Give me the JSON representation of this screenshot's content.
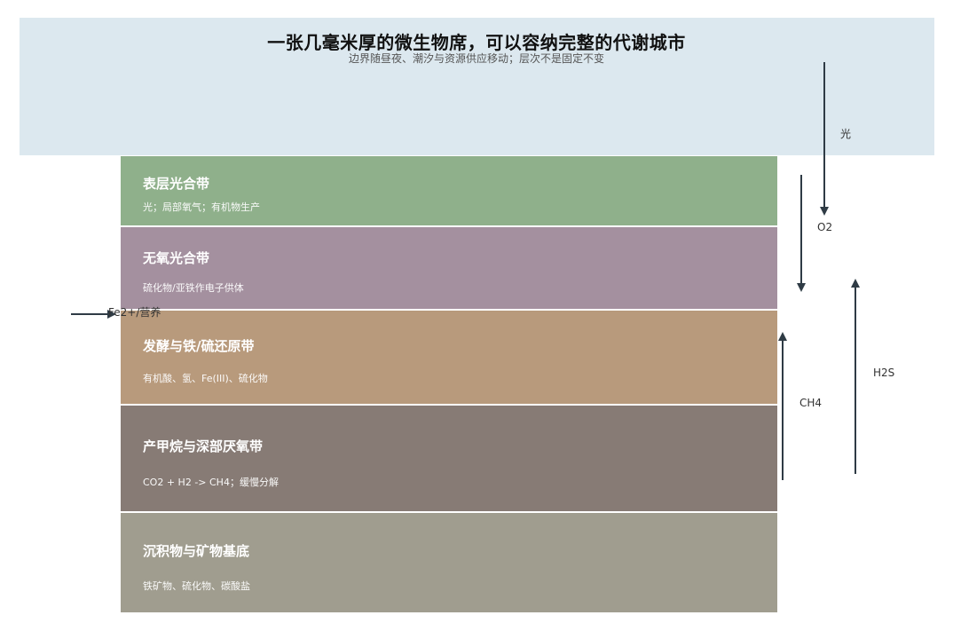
{
  "header": {
    "title": "一张几毫米厚的微生物席，可以容纳完整的代谢城市",
    "subtitle": "边界随昼夜、潮汐与资源供应移动；层次不是固定不变"
  },
  "layers": [
    {
      "name": "表层光合带",
      "desc": "光；局部氧气；有机物生产",
      "color": "#8fb08b"
    },
    {
      "name": "无氧光合带",
      "desc": "硫化物/亚铁作电子供体",
      "color": "#a4909f"
    },
    {
      "name": "发酵与铁/硫还原带",
      "desc": "有机酸、氢、Fe(III)、硫化物",
      "color": "#b89a7c"
    },
    {
      "name": "产甲烷与深部厌氧带",
      "desc": "CO2 + H2 -> CH4；缓慢分解",
      "color": "#877b75"
    },
    {
      "name": "沉积物与矿物基底",
      "desc": "铁矿物、硫化物、碳酸盐",
      "color": "#a09d8f"
    }
  ],
  "flows": {
    "light": "光",
    "o2": "O2",
    "h2s": "H2S",
    "ch4": "CH4",
    "fe": "Fe2+/营养"
  },
  "colors": {
    "sky": "#dce8ef",
    "arrow": "#2f3b45"
  }
}
